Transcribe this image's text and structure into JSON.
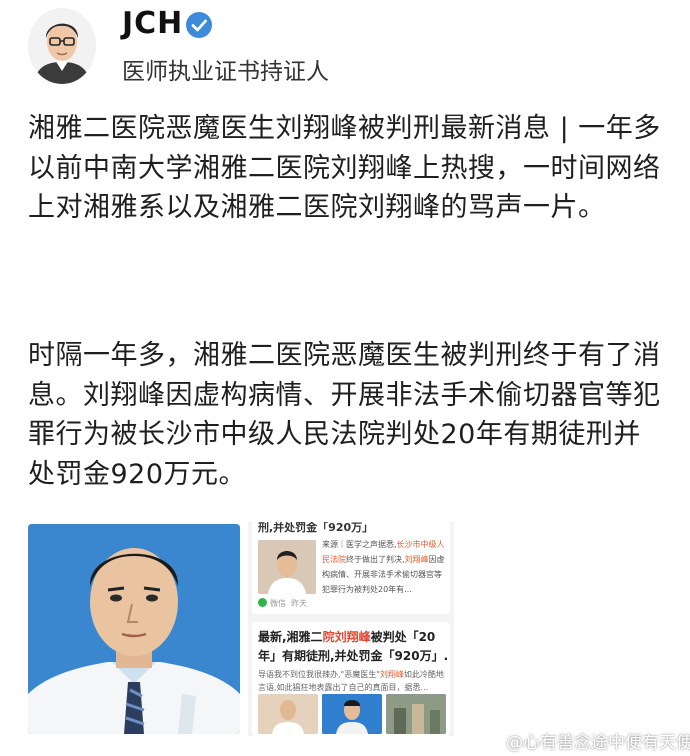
{
  "author": {
    "name": "JCH",
    "subtitle": "医师执业证书持证人"
  },
  "post": {
    "paragraph1": "湘雅二医院恶魔医生刘翔峰被判刑最新消息 | 一年多以前中南大学湘雅二医院刘翔峰上热搜，一时间网络上对湘雅系以及湘雅二医院刘翔峰的骂声一片。",
    "paragraph2": "时隔一年多，湘雅二医院恶魔医生被判刑终于有了消息。刘翔峰因虚构病情、开展非法手术偷切器官等犯罪行为被长沙市中级人民法院判处20年有期徒刑并处罚金920万元。"
  },
  "news_card_1": {
    "headline": "刑,并处罚金「920万」",
    "snippet_source": "来源｜医学之声据悉,",
    "snippet_highlight_1": "长沙市中级人民法院",
    "snippet_mid": "终于做出了判决,",
    "snippet_highlight_2": "刘翔峰",
    "snippet_tail": "因虚构病情、开展非法手术偷切器官等犯罪行为被判处20年有...",
    "source": "微信",
    "time": "昨天"
  },
  "news_card_2": {
    "title_a": "最新,湘雅二",
    "title_red": "院刘翔峰",
    "title_b": "被判处「20年」有期徒刑,并处罚金「920万」.",
    "sub_a": "导语我不到位我很辣办,\"恶魔医生\"",
    "sub_hl": "刘翔峰",
    "sub_b": "如此冷酷地言语,如此猖狂地表露出了自己的真面目，据悉..."
  },
  "watermark": "@心有善念途中便有天使",
  "colors": {
    "verified_badge": "#3d8bd9",
    "photo_background": "#3a87cf",
    "highlight": "#e35b2a",
    "wechat_green": "#2fb34a"
  }
}
